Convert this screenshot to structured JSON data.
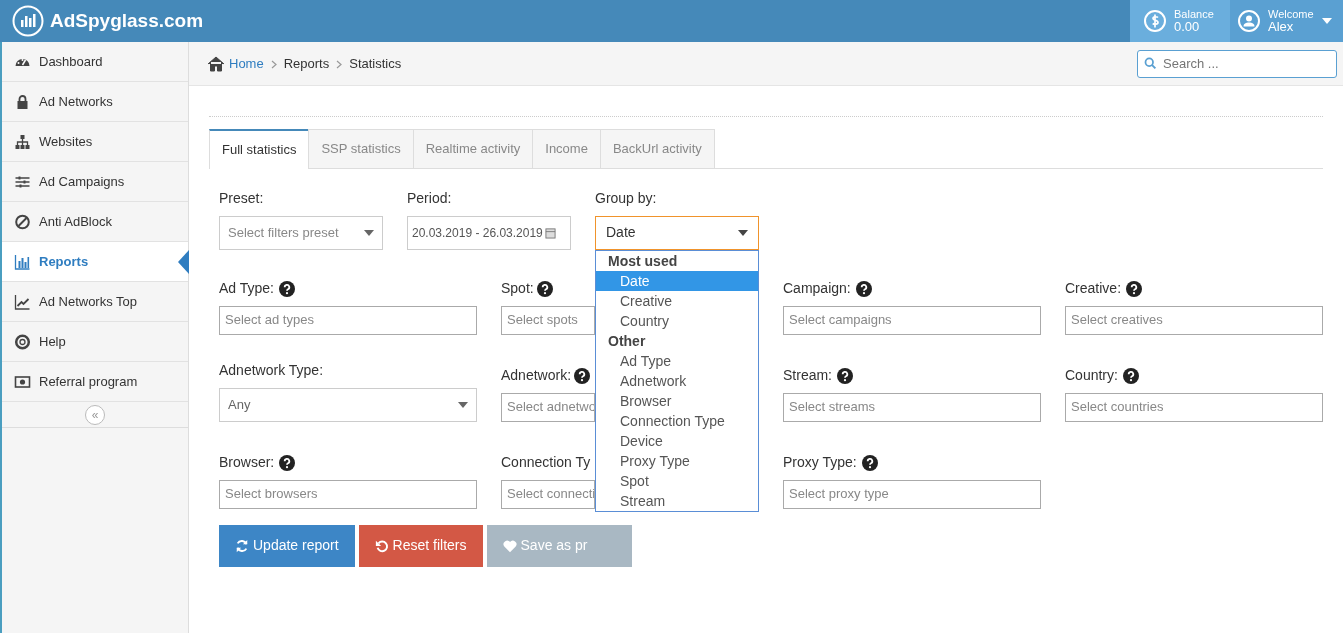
{
  "brand": {
    "name": "AdSpyglass.com"
  },
  "header": {
    "balance_label": "Balance",
    "balance": "0.00",
    "welcome": "Welcome",
    "user": "Alex"
  },
  "sidebar": {
    "items": [
      {
        "label": "Dashboard",
        "selected": false
      },
      {
        "label": "Ad Networks",
        "selected": false
      },
      {
        "label": "Websites",
        "selected": false
      },
      {
        "label": "Ad Campaigns",
        "selected": false
      },
      {
        "label": "Anti AdBlock",
        "selected": false
      },
      {
        "label": "Reports",
        "selected": true
      },
      {
        "label": "Ad Networks Top",
        "selected": false
      },
      {
        "label": "Help",
        "selected": false
      },
      {
        "label": "Referral program",
        "selected": false
      }
    ],
    "collapse": "«"
  },
  "breadcrumb": [
    "Home",
    "Reports",
    "Statistics"
  ],
  "search": {
    "placeholder": "Search ..."
  },
  "tabs": [
    {
      "label": "Full statistics",
      "selected": true
    },
    {
      "label": "SSP statistics",
      "selected": false
    },
    {
      "label": "Realtime activity",
      "selected": false
    },
    {
      "label": "Income",
      "selected": false
    },
    {
      "label": "BackUrl activity",
      "selected": false
    }
  ],
  "preset": {
    "label": "Preset:",
    "placeholder": "Select filters preset"
  },
  "period": {
    "label": "Period:",
    "value": "20.03.2019 - 26.03.2019"
  },
  "group_by": {
    "label": "Group by:",
    "value": "Date",
    "expanded": true,
    "options": [
      {
        "group": "Most used",
        "items": [
          {
            "label": "Date",
            "selected": true
          },
          {
            "label": "Creative",
            "selected": false
          },
          {
            "label": "Country",
            "selected": false
          }
        ]
      },
      {
        "group": "Other",
        "items": [
          {
            "label": "Ad Type",
            "selected": false
          },
          {
            "label": "Adnetwork",
            "selected": false
          },
          {
            "label": "Browser",
            "selected": false
          },
          {
            "label": "Connection Type",
            "selected": false
          },
          {
            "label": "Device",
            "selected": false
          },
          {
            "label": "Proxy Type",
            "selected": false
          },
          {
            "label": "Spot",
            "selected": false
          },
          {
            "label": "Stream",
            "selected": false
          }
        ]
      }
    ]
  },
  "filters": [
    {
      "label": "Ad Type:",
      "help": true,
      "kind": "text",
      "placeholder": "Select ad types"
    },
    {
      "label": "Spot:",
      "help": true,
      "kind": "text",
      "placeholder": "Select spots"
    },
    {
      "label": "Campaign:",
      "help": true,
      "kind": "text",
      "placeholder": "Select campaigns"
    },
    {
      "label": "Creative:",
      "help": true,
      "kind": "text",
      "placeholder": "Select creatives"
    },
    {
      "label": "Adnetwork Type:",
      "help": false,
      "kind": "select",
      "value": "Any"
    },
    {
      "label": "Adnetwork:",
      "help": true,
      "kind": "text",
      "placeholder": "Select adnetwo"
    },
    {
      "label": "Stream:",
      "help": true,
      "kind": "text",
      "placeholder": "Select streams"
    },
    {
      "label": "Country:",
      "help": true,
      "kind": "text",
      "placeholder": "Select countries"
    },
    {
      "label": "Browser:",
      "help": true,
      "kind": "text",
      "placeholder": "Select browsers"
    },
    {
      "label": "Connection Ty",
      "help": false,
      "kind": "text",
      "placeholder": "Select connecti"
    },
    {
      "label": "Proxy Type:",
      "help": true,
      "kind": "text",
      "placeholder": "Select proxy type"
    }
  ],
  "buttons": [
    {
      "label": "Update report",
      "kind": "primary"
    },
    {
      "label": "Reset filters",
      "kind": "danger"
    },
    {
      "label": "Save as pr",
      "kind": "muted"
    }
  ]
}
